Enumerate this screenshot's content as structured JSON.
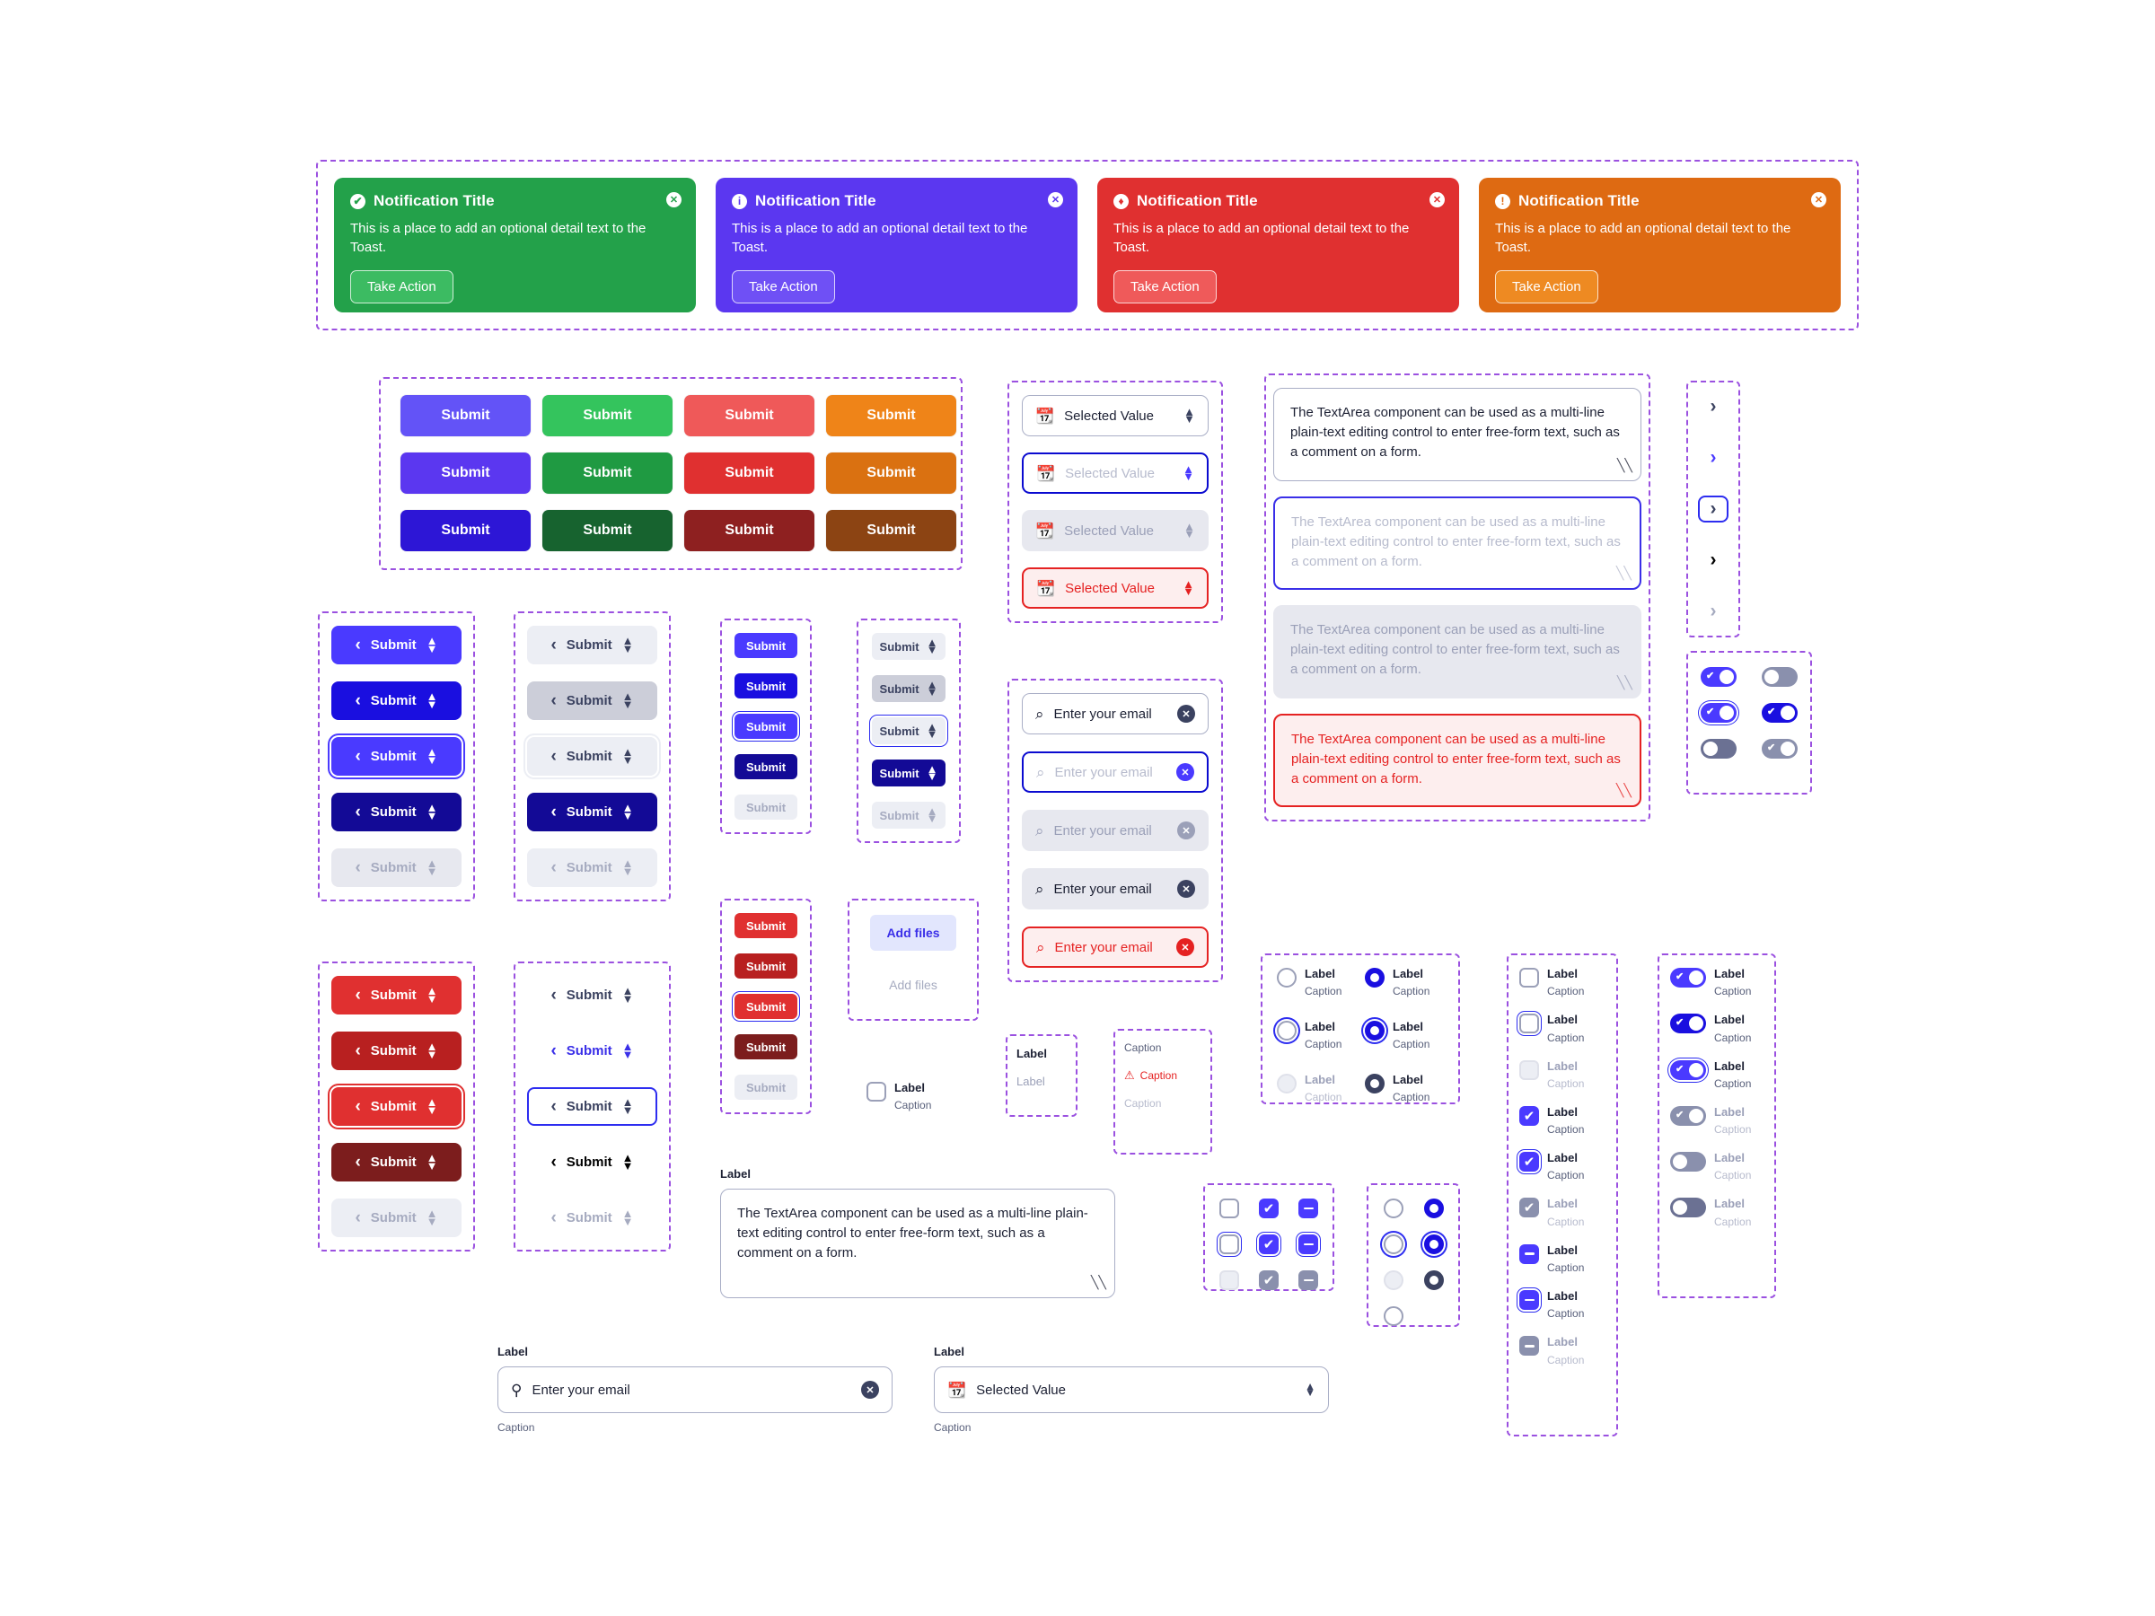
{
  "colors": {
    "guide": "#9b51e0",
    "primary": "#4a3aff",
    "primary_dark": "#1a0fe0",
    "primary_darkest": "#1a0fb0",
    "blue_focus": "#3a2fe8",
    "green": "#2ab04e",
    "green_mid": "#1f9a42",
    "green_dark": "#17632f",
    "red": "#ea4b4b",
    "red_mid": "#d92d2d",
    "red_dark": "#8e2020",
    "orange": "#ef8418",
    "orange_mid": "#da7111",
    "orange_dark": "#8c4413",
    "grey_bg": "#e7e8ef",
    "grey_mid": "#ccced9",
    "grey_text": "#a6abc0",
    "muted": "#7d83a0",
    "border": "#a9aec6",
    "danger": "#e52222",
    "danger_bg": "#fdeeee"
  },
  "toasts": [
    {
      "icon": "check-circle-icon",
      "glyph": "✔",
      "title": "Notification Title",
      "body": "This is a place to add an optional detail text to the Toast.",
      "action": "Take Action",
      "bg": "#23a14a",
      "action_bg": "#3cbb62",
      "icon_color": "#23a14a"
    },
    {
      "icon": "info-circle-icon",
      "glyph": "i",
      "title": "Notification Title",
      "body": "This is a place to add an optional detail text to the Toast.",
      "action": "Take Action",
      "bg": "#5b37f0",
      "action_bg": "#6f50f5",
      "icon_color": "#5b37f0"
    },
    {
      "icon": "warning-diamond-icon",
      "glyph": "♦",
      "title": "Notification Title",
      "body": "This is a place to add an optional detail text to the Toast.",
      "action": "Take Action",
      "bg": "#e03030",
      "action_bg": "#ef5a5a",
      "icon_color": "#e03030"
    },
    {
      "icon": "alert-circle-icon",
      "glyph": "!",
      "title": "Notification Title",
      "body": "This is a place to add an optional detail text to the Toast.",
      "action": "Take Action",
      "bg": "#de6a12",
      "action_bg": "#ee8a22",
      "icon_color": "#de6a12"
    }
  ],
  "toast_close_label": "✕",
  "button_grid": {
    "label": "Submit",
    "rows": [
      [
        {
          "bg": "#6353f7"
        },
        {
          "bg": "#34c45d"
        },
        {
          "bg": "#ef5959"
        },
        {
          "bg": "#ef8418"
        }
      ],
      [
        {
          "bg": "#5b37f0"
        },
        {
          "bg": "#1f9a42"
        },
        {
          "bg": "#e03030"
        },
        {
          "bg": "#da7111"
        }
      ],
      [
        {
          "bg": "#2d16d6"
        },
        {
          "bg": "#17632f"
        },
        {
          "bg": "#8e2020"
        },
        {
          "bg": "#8c4413"
        }
      ]
    ]
  },
  "chevron_cols": {
    "label": "Submit",
    "chevron_left": "‹",
    "stepper_up": "▲",
    "stepper_down": "▼",
    "primary": [
      {
        "bg": "#4a3aff",
        "fg": "#ffffff",
        "state": "default"
      },
      {
        "bg": "#1a0fe0",
        "fg": "#ffffff",
        "state": "hover"
      },
      {
        "bg": "#4a3aff",
        "fg": "#ffffff",
        "state": "focus"
      },
      {
        "bg": "#130a96",
        "fg": "#ffffff",
        "state": "pressed"
      },
      {
        "bg": "#e7e8ef",
        "fg": "#a6abc0",
        "state": "disabled"
      }
    ],
    "secondary": [
      {
        "bg": "#eceef4",
        "fg": "#3b4260",
        "state": "default"
      },
      {
        "bg": "#ccced9",
        "fg": "#3b4260",
        "state": "hover"
      },
      {
        "bg": "#eceef4",
        "fg": "#3b4260",
        "state": "focus"
      },
      {
        "bg": "#130a96",
        "fg": "#ffffff",
        "state": "pressed"
      },
      {
        "bg": "#eceef4",
        "fg": "#a6abc0",
        "state": "disabled"
      }
    ],
    "danger": [
      {
        "bg": "#e03030",
        "fg": "#ffffff",
        "state": "default"
      },
      {
        "bg": "#b82020",
        "fg": "#ffffff",
        "state": "hover"
      },
      {
        "bg": "#e03030",
        "fg": "#ffffff",
        "state": "focus"
      },
      {
        "bg": "#7c1d1d",
        "fg": "#ffffff",
        "state": "pressed"
      },
      {
        "bg": "#eceef4",
        "fg": "#a6abc0",
        "state": "disabled"
      }
    ],
    "ghost": [
      {
        "bg": "transparent",
        "fg": "#3b4260",
        "state": "default"
      },
      {
        "bg": "transparent",
        "fg": "#3a2fe8",
        "state": "hover"
      },
      {
        "bg": "#ffffff",
        "fg": "#3b4260",
        "state": "focus"
      },
      {
        "bg": "transparent",
        "fg": "#000000",
        "state": "pressed"
      },
      {
        "bg": "transparent",
        "fg": "#a6abc0",
        "state": "disabled"
      }
    ]
  },
  "small_buttons": {
    "label": "Submit",
    "primary": [
      {
        "bg": "#4a3aff",
        "fg": "#ffffff"
      },
      {
        "bg": "#1a0fe0",
        "fg": "#ffffff"
      },
      {
        "bg": "#4a3aff",
        "fg": "#ffffff"
      },
      {
        "bg": "#130a96",
        "fg": "#ffffff"
      },
      {
        "bg": "#eceef4",
        "fg": "#a6abc0"
      }
    ],
    "danger": [
      {
        "bg": "#e03030",
        "fg": "#ffffff"
      },
      {
        "bg": "#b82020",
        "fg": "#ffffff"
      },
      {
        "bg": "#e03030",
        "fg": "#ffffff"
      },
      {
        "bg": "#7c1d1d",
        "fg": "#ffffff"
      },
      {
        "bg": "#eceef4",
        "fg": "#a6abc0"
      }
    ],
    "steppers": [
      {
        "bg": "#eceef4",
        "fg": "#3b4260"
      },
      {
        "bg": "#ccced9",
        "fg": "#3b4260"
      },
      {
        "bg": "#eceef4",
        "fg": "#3b4260"
      },
      {
        "bg": "#130a96",
        "fg": "#ffffff"
      },
      {
        "bg": "#eceef4",
        "fg": "#a6abc0"
      }
    ]
  },
  "add_files": {
    "active_label": "Add files",
    "disabled_label": "Add files",
    "active_bg": "#e2e6fd",
    "active_fg": "#3a2fe8",
    "disabled_fg": "#a6abc0",
    "checkbox_label": "Label",
    "checkbox_caption": "Caption"
  },
  "selects": {
    "icon": "calendar-icon",
    "value": "Selected Value",
    "variants": [
      {
        "state": "default",
        "bg": "#ffffff",
        "border": "#a9aec6",
        "fg": "#1c2033",
        "icon_fg": "#3b4260"
      },
      {
        "state": "focus",
        "bg": "#ffffff",
        "border": "#0a0ad0",
        "fg": "#b7bbcd",
        "icon_fg": "#4a3aff"
      },
      {
        "state": "disabled",
        "bg": "#e7e8ef",
        "border": "#e7e8ef",
        "fg": "#9ba0b8",
        "icon_fg": "#9ba0b8"
      },
      {
        "state": "error",
        "bg": "#fdeeee",
        "border": "#e52222",
        "fg": "#e52222",
        "icon_fg": "#e52222"
      }
    ]
  },
  "email_inputs": {
    "icon": "search-icon",
    "clear_icon": "clear-circle-icon",
    "value": "Enter your email",
    "variants": [
      {
        "state": "default",
        "bg": "#ffffff",
        "border": "#a9aec6",
        "fg": "#1c2033",
        "clear_bg": "#3b4260"
      },
      {
        "state": "focus",
        "bg": "#ffffff",
        "border": "#0a0ad0",
        "fg": "#b7bbcd",
        "clear_bg": "#4a3aff"
      },
      {
        "state": "disabled",
        "bg": "#e7e8ef",
        "border": "#e7e8ef",
        "fg": "#9ba0b8",
        "clear_bg": "#9ba0b8"
      },
      {
        "state": "filled",
        "bg": "#e7e8ef",
        "border": "#e7e8ef",
        "fg": "#1c2033",
        "clear_bg": "#3b4260"
      },
      {
        "state": "error",
        "bg": "#fdeeee",
        "border": "#e52222",
        "fg": "#e52222",
        "clear_bg": "#e52222"
      }
    ]
  },
  "textareas": {
    "text": "The TextArea component can be used as a multi-line plain-text editing control to enter free-form text, such as a comment on a form.",
    "variants": [
      {
        "state": "default",
        "bg": "#ffffff",
        "border": "#a9aec6",
        "fg": "#1c2033",
        "h": 104
      },
      {
        "state": "focus",
        "bg": "#ffffff",
        "border": "#3a2fe8",
        "fg": "#b7bbcd",
        "h": 104
      },
      {
        "state": "disabled",
        "bg": "#e7e8ef",
        "border": "#e7e8ef",
        "fg": "#9ba0b8",
        "h": 104
      },
      {
        "state": "error",
        "bg": "#fdeeee",
        "border": "#e52222",
        "fg": "#e52222",
        "h": 104
      }
    ]
  },
  "chevron_icon_buttons": {
    "glyph": "›",
    "items": [
      {
        "fg": "#3b4260",
        "state": "default"
      },
      {
        "fg": "#4a3aff",
        "state": "hover"
      },
      {
        "fg": "#3b4260",
        "state": "focus"
      },
      {
        "fg": "#000000",
        "state": "pressed"
      },
      {
        "fg": "#a6abc0",
        "state": "disabled"
      }
    ]
  },
  "switch_grid": [
    {
      "on": true,
      "bg": "#4a3aff",
      "focus": false
    },
    {
      "on": false,
      "bg": "#8a90ad",
      "focus": false
    },
    {
      "on": true,
      "bg": "#4a3aff",
      "focus": true
    },
    {
      "on": true,
      "bg": "#1a0fe0",
      "focus": false
    },
    {
      "on": false,
      "bg": "#6b7193",
      "focus": false
    },
    {
      "on": true,
      "bg": "#8a90ad",
      "focus": false
    }
  ],
  "label_caption_boxes": {
    "label_group": [
      {
        "text": "Label",
        "style": "strong"
      },
      {
        "text": "Label",
        "style": "muted"
      }
    ],
    "caption_group": [
      {
        "text": "Caption",
        "style": "normal",
        "icon": ""
      },
      {
        "text": "Caption",
        "style": "error",
        "icon": "warning-triangle-icon"
      },
      {
        "text": "Caption",
        "style": "muted",
        "icon": ""
      }
    ]
  },
  "radio_group": {
    "label": "Label",
    "caption": "Caption",
    "items": [
      {
        "checked": false,
        "state": "default"
      },
      {
        "checked": true,
        "state": "default"
      },
      {
        "checked": false,
        "state": "focus"
      },
      {
        "checked": true,
        "state": "focus"
      },
      {
        "checked": false,
        "state": "disabled"
      },
      {
        "checked": true,
        "state": "pressed"
      }
    ]
  },
  "checkbox_column": {
    "label": "Label",
    "caption": "Caption",
    "items": [
      {
        "mark": "none",
        "state": "default"
      },
      {
        "mark": "none",
        "state": "focus"
      },
      {
        "mark": "none",
        "state": "disabled"
      },
      {
        "mark": "check",
        "state": "default"
      },
      {
        "mark": "check",
        "state": "focus"
      },
      {
        "mark": "check",
        "state": "disabled"
      },
      {
        "mark": "dash",
        "state": "default"
      },
      {
        "mark": "dash",
        "state": "focus"
      },
      {
        "mark": "dash",
        "state": "disabled"
      }
    ]
  },
  "switch_column": {
    "label": "Label",
    "caption": "Caption",
    "items": [
      {
        "on": true,
        "bg": "#4a3aff",
        "state": "default"
      },
      {
        "on": true,
        "bg": "#1a0fe0",
        "state": "hover"
      },
      {
        "on": true,
        "bg": "#4a3aff",
        "state": "focus"
      },
      {
        "on": true,
        "bg": "#8a90ad",
        "state": "disabled"
      },
      {
        "on": false,
        "bg": "#8a90ad",
        "state": "off"
      },
      {
        "on": false,
        "bg": "#6b7193",
        "state": "off-hover"
      }
    ]
  },
  "checkbox_matrix": [
    [
      {
        "mark": "none",
        "state": "default"
      },
      {
        "mark": "check",
        "state": "default"
      },
      {
        "mark": "dash",
        "state": "default"
      }
    ],
    [
      {
        "mark": "none",
        "state": "focus"
      },
      {
        "mark": "check",
        "state": "focus"
      },
      {
        "mark": "dash",
        "state": "focus"
      }
    ],
    [
      {
        "mark": "none",
        "state": "disabled"
      },
      {
        "mark": "check",
        "state": "disabled"
      },
      {
        "mark": "dash",
        "state": "disabled"
      }
    ]
  ],
  "radio_matrix": [
    [
      {
        "checked": false,
        "state": "default"
      },
      {
        "checked": true,
        "state": "default"
      }
    ],
    [
      {
        "checked": false,
        "state": "focus"
      },
      {
        "checked": true,
        "state": "focus"
      }
    ],
    [
      {
        "checked": false,
        "state": "disabled"
      },
      {
        "checked": true,
        "state": "pressed"
      }
    ],
    [
      {
        "checked": false,
        "state": "default2"
      }
    ]
  ],
  "big_textarea": {
    "label": "Label",
    "text": "The TextArea component can be used as a multi-line plain-text editing control to enter free-form text, such as a comment on a form."
  },
  "bottom_fields": {
    "email": {
      "label": "Label",
      "value": "Enter your email",
      "caption": "Caption",
      "icon": "search-icon",
      "clear_icon": "clear-circle-icon"
    },
    "select": {
      "label": "Label",
      "value": "Selected Value",
      "caption": "Caption",
      "icon": "calendar-icon"
    }
  }
}
